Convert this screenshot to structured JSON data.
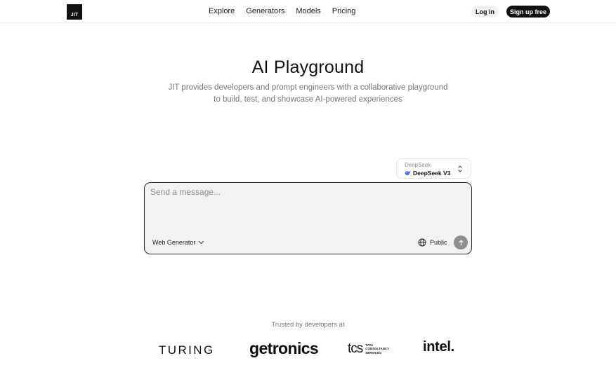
{
  "header": {
    "logo_text": "JIT",
    "nav": [
      "Explore",
      "Generators",
      "Models",
      "Pricing"
    ],
    "login_label": "Log in",
    "signup_label": "Sign up free"
  },
  "hero": {
    "title": "AI Playground",
    "subtitle": "JIT provides developers and prompt engineers with a collaborative playground to build, test, and showcase AI-powered experiences"
  },
  "model_selector": {
    "provider": "DeepSeek",
    "model": "DeepSeek V3",
    "icon": "deepseek-whale-icon"
  },
  "prompt": {
    "placeholder": "Send a message...",
    "generator_label": "Web Generator",
    "visibility_label": "Public"
  },
  "trusted": {
    "label": "Trusted by developers at",
    "logos": {
      "turing": "TURING",
      "getronics": "getronics",
      "tcs_mark": "tcs",
      "tcs_line1": "TATA",
      "tcs_line2": "CONSULTANCY",
      "tcs_line3": "SERVICES",
      "intel": "intel."
    }
  },
  "colors": {
    "primary": "#111111",
    "muted_text": "#777777",
    "input_bg": "#f2f2f2",
    "send_button": "#8e8e8e",
    "deepseek_blue": "#4d6bfe"
  }
}
